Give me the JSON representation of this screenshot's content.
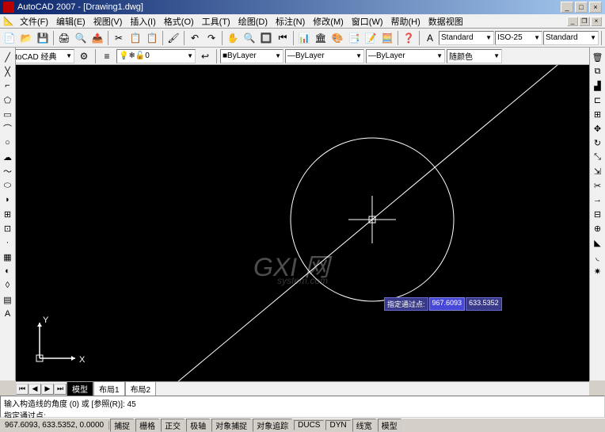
{
  "title": "AutoCAD 2007 - [Drawing1.dwg]",
  "menu": {
    "items": [
      "文件(F)",
      "编辑(E)",
      "视图(V)",
      "插入(I)",
      "格式(O)",
      "工具(T)",
      "绘图(D)",
      "标注(N)",
      "修改(M)",
      "窗口(W)",
      "帮助(H)",
      "数据视图"
    ]
  },
  "layer_row": {
    "workspace": "AutoCAD 经典",
    "layer_dd": "0",
    "linetype_dd": "ByLayer",
    "lineweight_dd": "ByLayer",
    "color_dd": "ByLayer",
    "plotcolor_dd": "随颜色",
    "style_dd": "Standard",
    "dim_dd": "ISO-25",
    "tablestyle_dd": "Standard"
  },
  "dynamic_input": {
    "label": "指定通过点:",
    "val1": "967.6093",
    "val2": "633.5352"
  },
  "watermark": {
    "main": "GXI 网",
    "sub": "system.com"
  },
  "ucs": {
    "x": "X",
    "y": "Y"
  },
  "tabs": {
    "model": "模型",
    "layout1": "布局1",
    "layout2": "布局2"
  },
  "cmdline": {
    "line1": "输入构造线的角度 (0) 或 [参照(R)]:  45",
    "line2": "指定通过点:"
  },
  "statusbar": {
    "coords": "967.6093, 633.5352, 0.0000",
    "buttons": [
      "捕捉",
      "栅格",
      "正交",
      "极轴",
      "对象捕捉",
      "对象追踪",
      "DUCS",
      "DYN",
      "线宽",
      "模型"
    ]
  }
}
